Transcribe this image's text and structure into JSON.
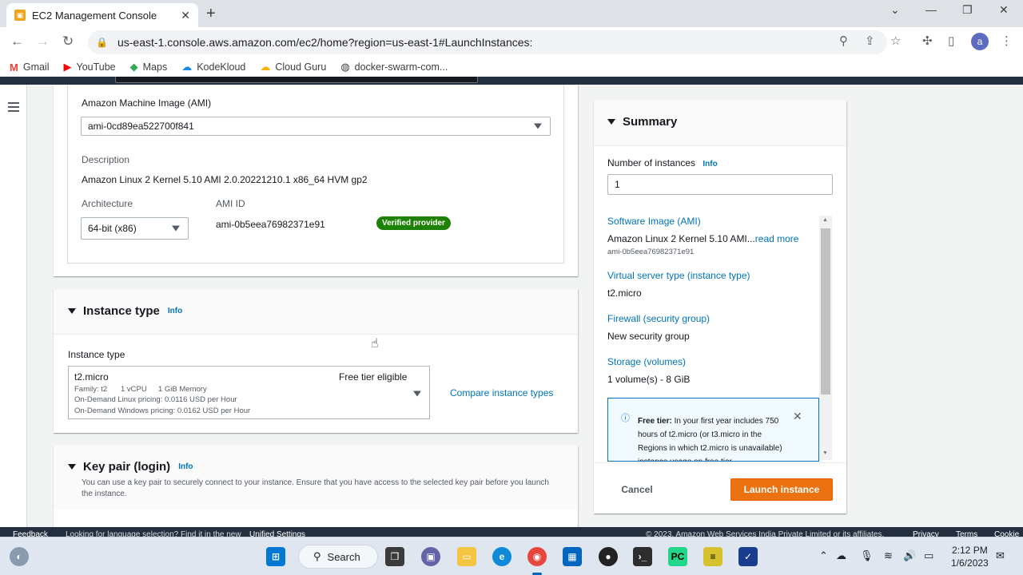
{
  "browser": {
    "tab_title": "EC2 Management Console",
    "url": "us-east-1.console.aws.amazon.com/ec2/home?region=us-east-1#LaunchInstances:",
    "bookmarks": [
      "Gmail",
      "YouTube",
      "Maps",
      "KodeKloud",
      "Cloud Guru",
      "docker-swarm-com..."
    ],
    "profile_initial": "a"
  },
  "ami": {
    "label": "Amazon Machine Image (AMI)",
    "selected": "ami-0cd89ea522700f841",
    "description_label": "Description",
    "description": "Amazon Linux 2 Kernel 5.10 AMI 2.0.20221210.1 x86_64 HVM gp2",
    "architecture_label": "Architecture",
    "architecture": "64-bit (x86)",
    "ami_id_label": "AMI ID",
    "ami_id": "ami-0b5eea76982371e91",
    "verified": "Verified provider"
  },
  "instance_type": {
    "title": "Instance type",
    "info": "Info",
    "field_label": "Instance type",
    "name": "t2.micro",
    "free_tier": "Free tier eligible",
    "family": "Family: t2",
    "vcpu": "1 vCPU",
    "memory": "1 GiB Memory",
    "linux_pricing": "On-Demand Linux pricing: 0.0116 USD per Hour",
    "windows_pricing": "On-Demand Windows pricing: 0.0162 USD per Hour",
    "compare": "Compare instance types"
  },
  "key_pair": {
    "title": "Key pair (login)",
    "info": "Info",
    "description": "You can use a key pair to securely connect to your instance. Ensure that you have access to the selected key pair before you launch the instance."
  },
  "summary": {
    "title": "Summary",
    "num_label": "Number of instances",
    "info": "Info",
    "num_value": "1",
    "software_label": "Software Image (AMI)",
    "software_value": "Amazon Linux 2 Kernel 5.10 AMI...",
    "read_more": "read more",
    "software_id": "ami-0b5eea76982371e91",
    "server_label": "Virtual server type (instance type)",
    "server_value": "t2.micro",
    "firewall_label": "Firewall (security group)",
    "firewall_value": "New security group",
    "storage_label": "Storage (volumes)",
    "storage_value": "1 volume(s) - 8 GiB",
    "free_tier_title": "Free tier:",
    "free_tier_text": "In your first year includes 750 hours of t2.micro (or t3.micro in the Regions in which t2.micro is unavailable) instance usage on free tier",
    "cancel": "Cancel",
    "launch": "Launch instance"
  },
  "footer": {
    "feedback": "Feedback",
    "language": "Looking for language selection? Find it in the new",
    "unified": "Unified Settings",
    "copyright": "© 2023, Amazon Web Services India Private Limited or its affiliates.",
    "privacy": "Privacy",
    "terms": "Terms",
    "cookie": "Cookie"
  },
  "taskbar": {
    "search": "Search",
    "time": "2:12 PM",
    "date": "1/6/2023"
  },
  "colors": {
    "aws_link": "#0073bb",
    "launch_orange": "#ec7211",
    "verified_green": "#1d8102",
    "aws_dark": "#232f3e"
  }
}
